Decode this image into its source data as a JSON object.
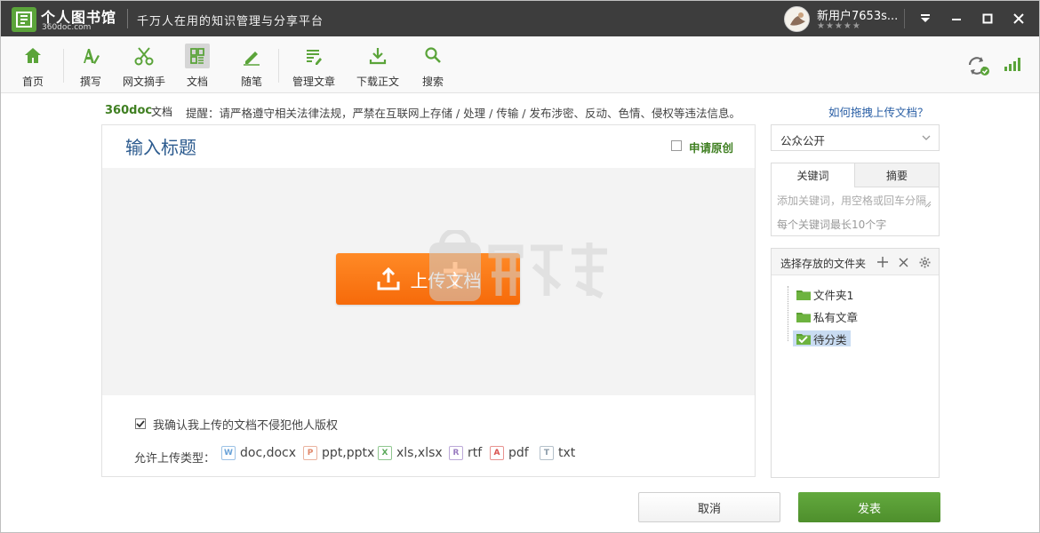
{
  "titlebar": {
    "app_name": "个人图书馆",
    "domain": "360doc.com",
    "slogan": "千万人在用的知识管理与分享平台",
    "username": "新用户7653s...",
    "stars": "★★★★★"
  },
  "toolbar": {
    "items": [
      {
        "label": "首页",
        "icon": "home-icon"
      },
      {
        "label": "撰写",
        "icon": "write-icon"
      },
      {
        "label": "网文摘手",
        "icon": "scissors-icon"
      },
      {
        "label": "文档",
        "icon": "document-icon"
      },
      {
        "label": "随笔",
        "icon": "pencil-icon"
      },
      {
        "label": "管理文章",
        "icon": "manage-icon"
      },
      {
        "label": "下载正文",
        "icon": "download-icon"
      },
      {
        "label": "搜索",
        "icon": "search-icon"
      }
    ],
    "active_index": 3
  },
  "notice": {
    "brand": "360doc",
    "sub": "文档",
    "text": "提醒：请严格遵守相关法律法规，严禁在互联网上存储 / 处理 / 传输 / 发布涉密、反动、色情、侵权等违法信息。",
    "help_link": "如何拖拽上传文档？"
  },
  "editor": {
    "title_placeholder": "输入标题",
    "original_label": "申请原创",
    "upload_label": "上传文档",
    "confirm_label": "我确认我上传的文档不侵犯他人版权",
    "confirm_checked": true,
    "types_label": "允许上传类型：",
    "file_types": [
      {
        "badge": "W",
        "label": "doc,docx",
        "color": "#6aa3d8"
      },
      {
        "badge": "P",
        "label": "ppt,pptx",
        "color": "#e0876a"
      },
      {
        "badge": "X",
        "label": "xls,xlsx",
        "color": "#5aa85a"
      },
      {
        "badge": "R",
        "label": "rtf",
        "color": "#9a7cc0"
      },
      {
        "badge": "A",
        "label": "pdf",
        "color": "#d9534f"
      },
      {
        "badge": "T",
        "label": "txt",
        "color": "#8a9aa8"
      }
    ]
  },
  "sidebar": {
    "visibility": "公众公开",
    "tabs": [
      "关键词",
      "摘要"
    ],
    "keyword_placeholder": "添加关键词，用空格或回车分隔",
    "keyword_hint": "每个关键词最长10个字",
    "folder_title": "选择存放的文件夹",
    "folders": [
      {
        "label": "文件夹1",
        "selected": false
      },
      {
        "label": "私有文章",
        "selected": false
      },
      {
        "label": "待分类",
        "selected": true
      }
    ]
  },
  "actions": {
    "cancel": "取消",
    "publish": "发表"
  },
  "colors": {
    "brand_green": "#4e8f2c",
    "upload_orange": "#f66a0a",
    "title_blue": "#2b5a8e"
  }
}
